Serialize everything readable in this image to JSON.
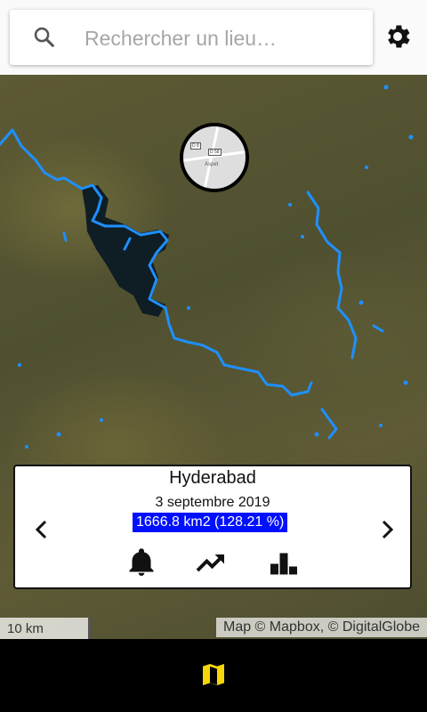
{
  "search": {
    "placeholder": "Rechercher un lieu…",
    "value": ""
  },
  "icons": {
    "search": "search-icon",
    "settings": "gear-icon",
    "prev": "chevron-left-icon",
    "next": "chevron-right-icon",
    "alerts": "bell-icon",
    "trend": "trending-up-icon",
    "stats": "bar-chart-icon",
    "map": "map-icon"
  },
  "locator_map": {
    "road_label_1": "D 8",
    "road_label_2": "D 58",
    "place": "Aspet"
  },
  "info_card": {
    "place": "Hyderabad",
    "date": "3 septembre 2019",
    "area": "1666.8 km2 (128.21 %)"
  },
  "map": {
    "scale": "10 km",
    "attribution": "Map © Mapbox, © DigitalGlobe"
  },
  "colors": {
    "water_highlight": "#1e90ff",
    "area_badge": "#0010ff",
    "active_tab": "#f5d60a",
    "bottom_nav": "#000000"
  }
}
